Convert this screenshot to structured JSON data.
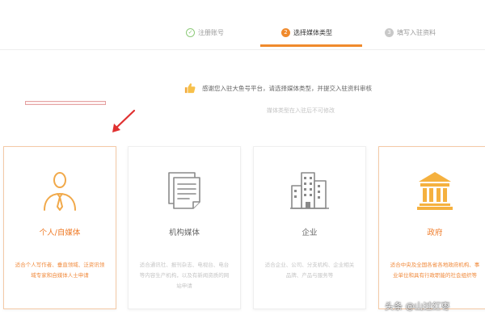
{
  "steps": [
    {
      "num": "✓",
      "label": "注册账号",
      "state": "done"
    },
    {
      "num": "2",
      "label": "选择媒体类型",
      "state": "active"
    },
    {
      "num": "3",
      "label": "填写入驻资料",
      "state": "todo"
    }
  ],
  "notice": {
    "icon": "thumbs-up-icon",
    "text": "感谢您入驻大鱼号平台，请选择媒体类型，并提交入驻资料审核",
    "sub": "媒体类型在入驻后不可修改"
  },
  "cards": [
    {
      "icon": "person-tie-icon",
      "title": "个人/自媒体",
      "desc": "适合个人写作者、垂直领域、泛资讯领域专家和自媒体人士申请"
    },
    {
      "icon": "documents-icon",
      "title": "机构媒体",
      "desc": "适合通讯社、报刊杂志、电视台、电台等内容生产机构，以及有新闻资质的网站申请"
    },
    {
      "icon": "buildings-icon",
      "title": "企业",
      "desc": "适合企业、公司、分支机构、企业相关品牌、产品与服务等"
    },
    {
      "icon": "government-building-icon",
      "title": "政府",
      "desc": "适合中央及全国各省各地政府机构、事业单位和具有行政职能的社会组织等"
    }
  ],
  "watermark": "头条 @山过红枣",
  "colors": {
    "accent": "#f08a2c",
    "done": "#8ecb7a",
    "muted": "#c5c5c5"
  }
}
